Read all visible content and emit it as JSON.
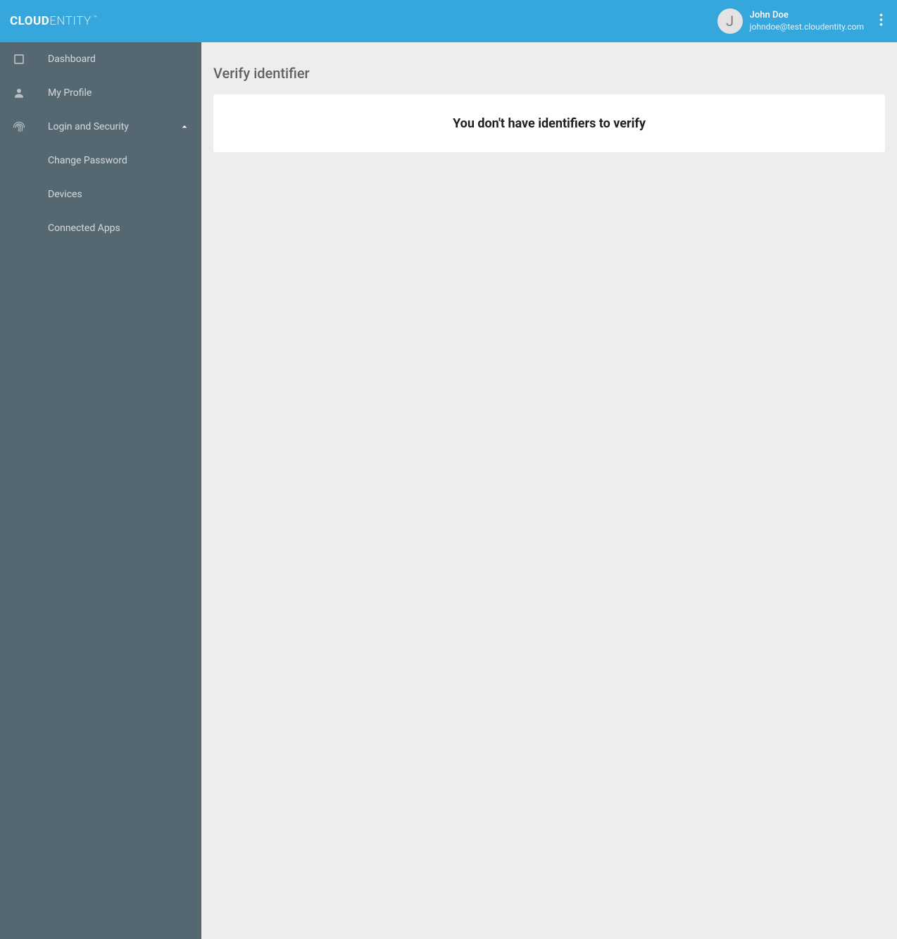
{
  "header": {
    "logo_bold": "CLOUD",
    "logo_light": "ENTITY",
    "logo_tm": "™",
    "user": {
      "initial": "J",
      "name": "John Doe",
      "email": "johndoe@test.cloudentity.com"
    }
  },
  "sidebar": {
    "items": [
      {
        "label": "Dashboard"
      },
      {
        "label": "My Profile"
      },
      {
        "label": "Login and Security"
      },
      {
        "label": "Change Password"
      },
      {
        "label": "Devices"
      },
      {
        "label": "Connected Apps"
      }
    ]
  },
  "main": {
    "title": "Verify identifier",
    "empty_message": "You don't have identifiers to verify"
  }
}
